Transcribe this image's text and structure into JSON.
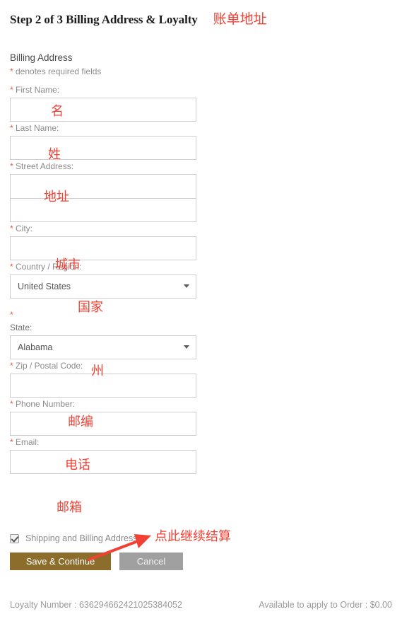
{
  "header": {
    "step_title": "Step 2 of 3 Billing Address & Loyalty",
    "annotation": "账单地址"
  },
  "section": {
    "heading": "Billing Address",
    "required_star": "*",
    "required_note": " denotes required fields"
  },
  "form": {
    "first_name": {
      "star": "*",
      "label": " First Name:",
      "value": "",
      "annotation": "名"
    },
    "last_name": {
      "star": "*",
      "label": " Last Name:",
      "value": "",
      "annotation": "姓"
    },
    "street_address": {
      "star": "*",
      "label": " Street Address:",
      "value_line1": "",
      "value_line2": "",
      "annotation": "地址"
    },
    "city": {
      "star": "*",
      "label": " City:",
      "value": "",
      "annotation": "城市"
    },
    "country": {
      "star": "*",
      "label": " Country / Region:",
      "selected": "United States",
      "caret": "chevron-down-icon",
      "annotation": "国家"
    },
    "state": {
      "star": "*",
      "label": "State:",
      "selected": "Alabama",
      "caret": "chevron-down-icon",
      "annotation": "州"
    },
    "zip": {
      "star": "*",
      "label": " Zip / Postal Code:",
      "value": "",
      "annotation": "邮编"
    },
    "phone": {
      "star": "*",
      "label": " Phone Number:",
      "value": "",
      "annotation": "电话"
    },
    "email": {
      "star": "*",
      "label": " Email:",
      "value": "",
      "annotation": "邮箱"
    }
  },
  "checkbox": {
    "label": "Shipping and Billing Address",
    "checked": true
  },
  "buttons": {
    "save": "Save & Continue",
    "cancel": "Cancel",
    "cta_annotation": "点此继续结算"
  },
  "footer": {
    "loyalty": "Loyalty Number : 636294662421025384052",
    "available": "Available to apply to Order : $0.00"
  },
  "colors": {
    "annotation_red": "#f04134",
    "required_star": "#e8574a",
    "save_button": "#8c6d2b",
    "cancel_button": "#a0a0a0",
    "label_gray": "#8a8a8a",
    "input_border": "#cfcfcf"
  }
}
